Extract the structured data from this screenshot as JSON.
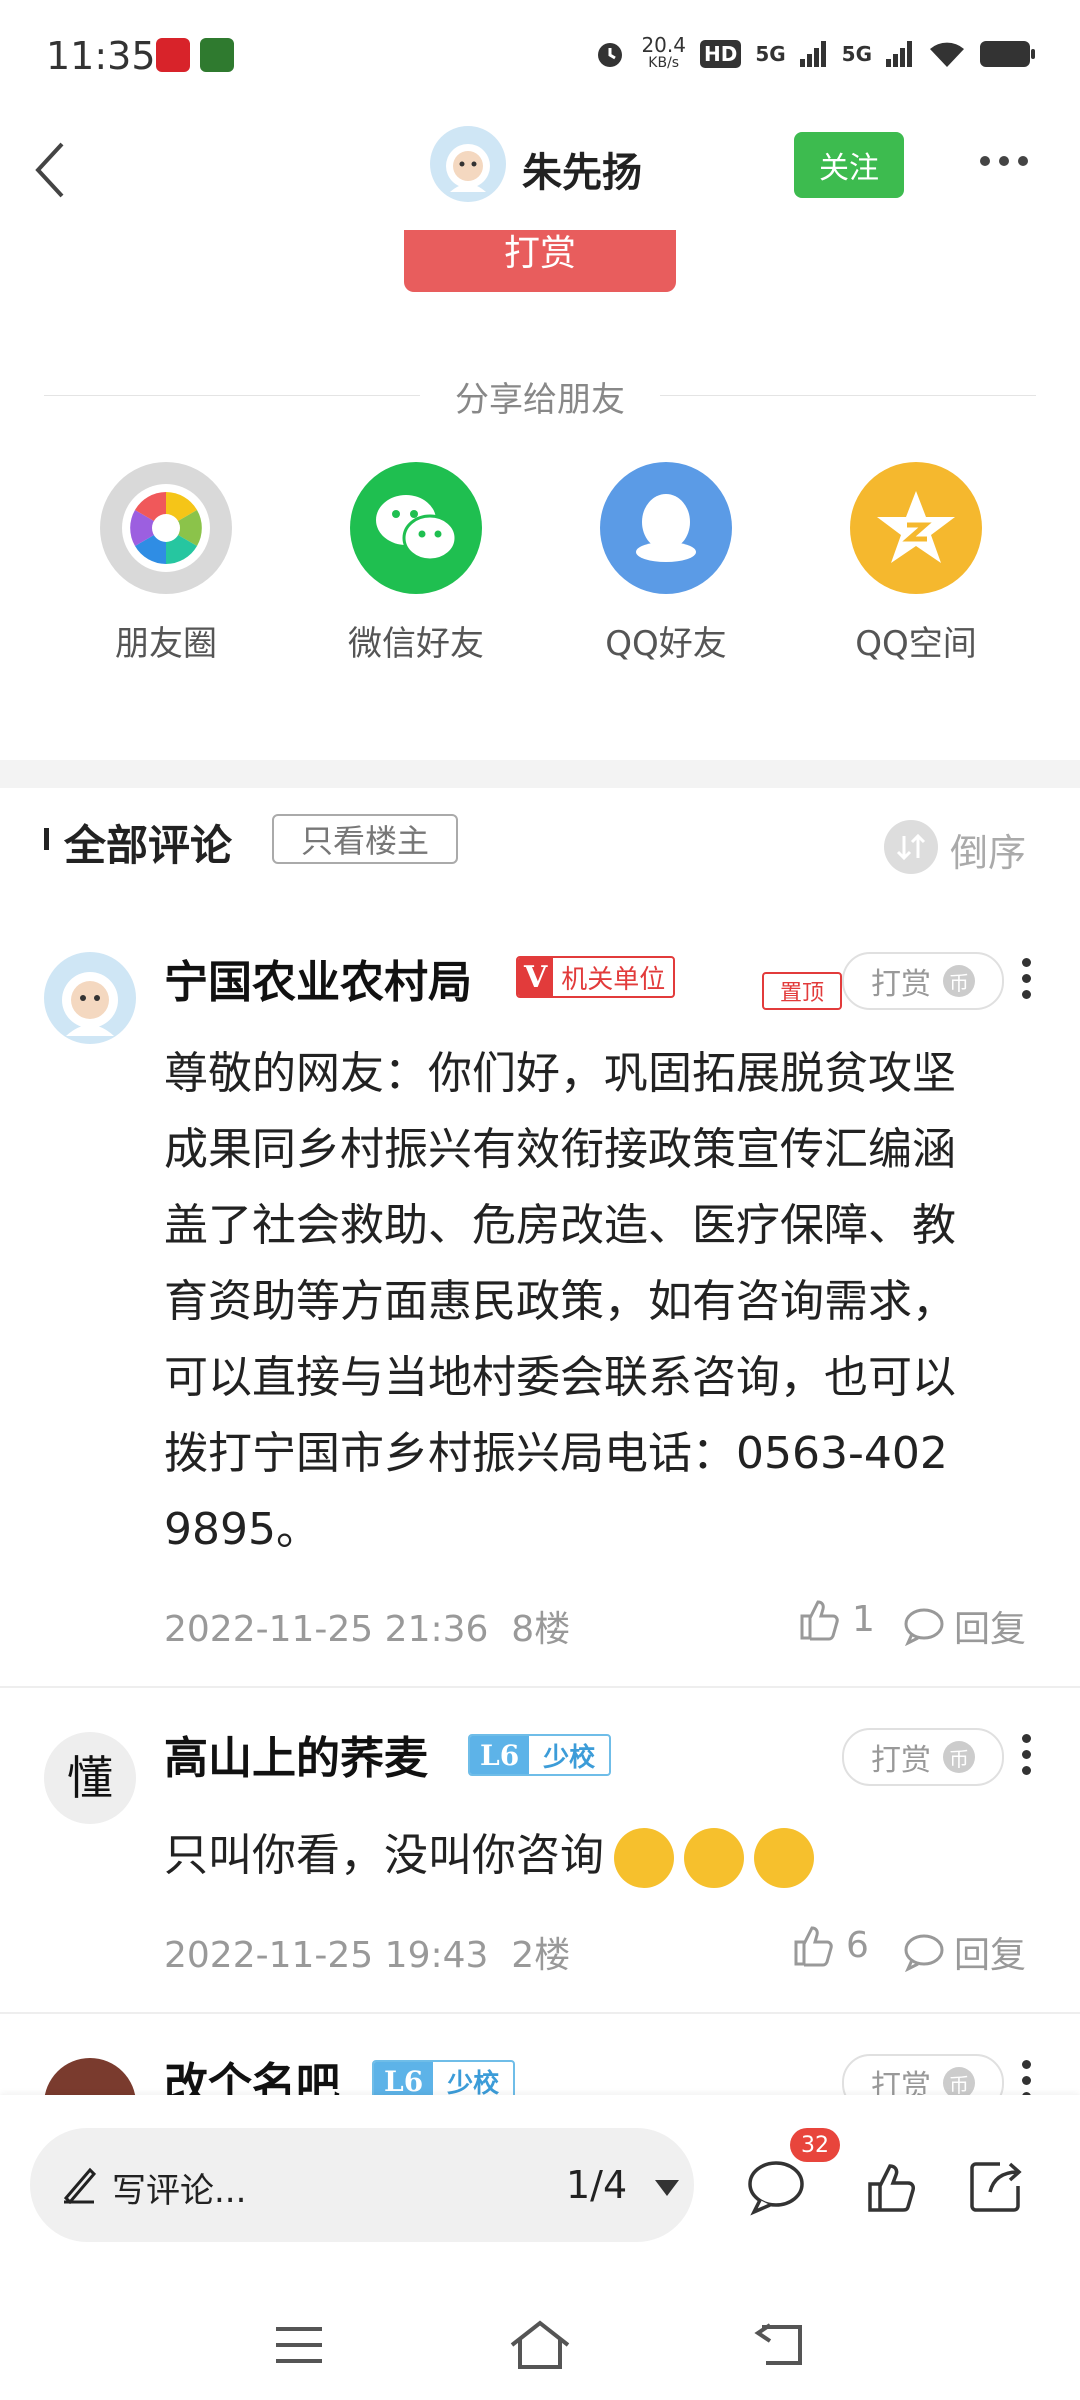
{
  "status_bar": {
    "time": "11:35",
    "net_speed_value": "20.4",
    "net_speed_unit": "KB/s",
    "hd": "HD",
    "sim1": "5G",
    "sim2": "5G"
  },
  "header": {
    "author_name": "朱先扬",
    "follow_label": "关注"
  },
  "reward_top_label": "打赏",
  "share": {
    "title": "分享给朋友",
    "items": [
      {
        "label": "朋友圈",
        "icon": "moments-icon"
      },
      {
        "label": "微信好友",
        "icon": "wechat-icon"
      },
      {
        "label": "QQ好友",
        "icon": "qq-icon"
      },
      {
        "label": "QQ空间",
        "icon": "qzone-icon"
      }
    ]
  },
  "comments_header": {
    "title": "全部评论",
    "only_op": "只看楼主",
    "order": "倒序"
  },
  "comments": [
    {
      "name": "宁国农业农村局",
      "badge_letter": "V",
      "badge_text": "机关单位",
      "pin": "置顶",
      "reward": "打赏",
      "lines": [
        "尊敬的网友：你们好，巩固拓展脱贫攻坚",
        "成果同乡村振兴有效衔接政策宣传汇编涵",
        "盖了社会救助、危房改造、医疗保障、教",
        "育资助等方面惠民政策，如有咨询需求，",
        "可以直接与当地村委会联系咨询，也可以",
        "拨打宁国市乡村振兴局电话：0563-402",
        "9895。"
      ],
      "time": "2022-11-25 21:36",
      "floor": "8楼",
      "likes": "1",
      "reply": "回复"
    },
    {
      "name": "高山上的荞麦",
      "badge_letter": "L6",
      "badge_text": "少校",
      "reward": "打赏",
      "text": "只叫你看，没叫你咨询",
      "avatar_char": "懂",
      "time": "2022-11-25 19:43",
      "floor": "2楼",
      "likes": "6",
      "reply": "回复"
    },
    {
      "name": "改个名吧",
      "badge_letter": "L6",
      "badge_text": "少校",
      "reward": "打赏"
    }
  ],
  "bottom_bar": {
    "write_placeholder": "写评论...",
    "page_indicator": "1/4",
    "comment_count": "32"
  }
}
